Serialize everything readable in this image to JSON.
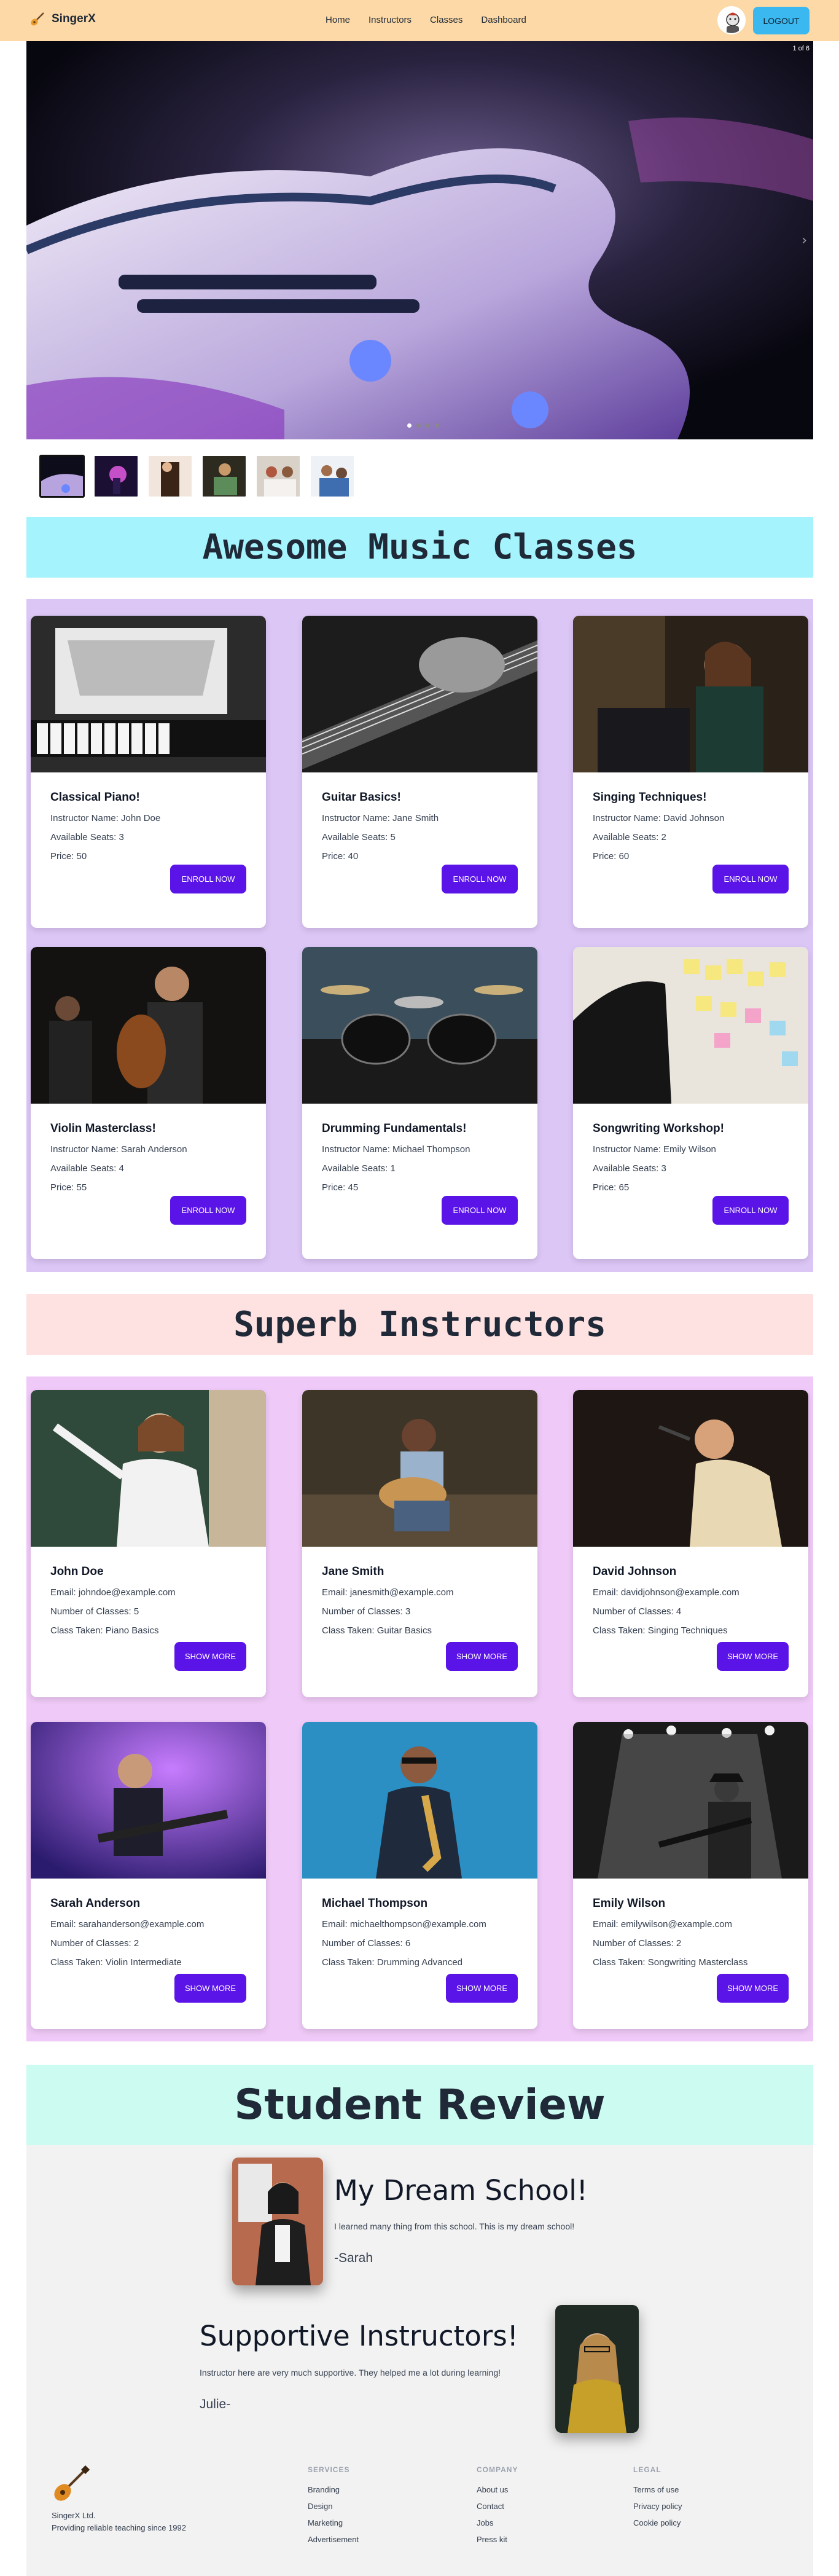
{
  "navbar": {
    "brand": "SingerX",
    "brand_icon": "guitar-icon",
    "links": [
      "Home",
      "Instructors",
      "Classes",
      "Dashboard"
    ],
    "logout_label": "LOGOUT"
  },
  "hero": {
    "counter": "1 of 6",
    "slide_count": 6,
    "active_slide": 1,
    "thumbnails": [
      "guitar",
      "concert",
      "violin",
      "guitarist",
      "duet",
      "band"
    ]
  },
  "classes_section": {
    "title": "Awesome Music Classes",
    "button_label": "ENROLL NOW",
    "cards": [
      {
        "title": "Classical Piano!",
        "instructor": "Instructor Name: John Doe",
        "seats": "Available Seats: 3",
        "price": "Price: 50"
      },
      {
        "title": "Guitar Basics!",
        "instructor": "Instructor Name: Jane Smith",
        "seats": "Available Seats: 5",
        "price": "Price: 40"
      },
      {
        "title": "Singing Techniques!",
        "instructor": "Instructor Name: David Johnson",
        "seats": "Available Seats: 2",
        "price": "Price: 60"
      },
      {
        "title": "Violin Masterclass!",
        "instructor": "Instructor Name: Sarah Anderson",
        "seats": "Available Seats: 4",
        "price": "Price: 55"
      },
      {
        "title": "Drumming Fundamentals!",
        "instructor": "Instructor Name: Michael Thompson",
        "seats": "Available Seats: 1",
        "price": "Price: 45"
      },
      {
        "title": "Songwriting Workshop!",
        "instructor": "Instructor Name: Emily Wilson",
        "seats": "Available Seats: 3",
        "price": "Price: 65"
      }
    ]
  },
  "instructors_section": {
    "title": "Superb Instructors",
    "button_label": "SHOW MORE",
    "cards": [
      {
        "name": "John Doe",
        "email": "Email: johndoe@example.com",
        "classes": "Number of Classes: 5",
        "taken": "Class Taken: Piano Basics"
      },
      {
        "name": "Jane Smith",
        "email": "Email: janesmith@example.com",
        "classes": "Number of Classes: 3",
        "taken": "Class Taken: Guitar Basics"
      },
      {
        "name": "David Johnson",
        "email": "Email: davidjohnson@example.com",
        "classes": "Number of Classes: 4",
        "taken": "Class Taken: Singing Techniques"
      },
      {
        "name": "Sarah Anderson",
        "email": "Email: sarahanderson@example.com",
        "classes": "Number of Classes: 2",
        "taken": "Class Taken: Violin Intermediate"
      },
      {
        "name": "Michael Thompson",
        "email": "Email: michaelthompson@example.com",
        "classes": "Number of Classes: 6",
        "taken": "Class Taken: Drumming Advanced"
      },
      {
        "name": "Emily Wilson",
        "email": "Email: emilywilson@example.com",
        "classes": "Number of Classes: 2",
        "taken": "Class Taken: Songwriting Masterclass"
      }
    ]
  },
  "review_section": {
    "title": "Student Review",
    "reviews": [
      {
        "heading": "My Dream School!",
        "text": "I learned many thing from this school. This is my dream school!",
        "author": "-Sarah"
      },
      {
        "heading": "Supportive Instructors!",
        "text": "Instructor here are very much supportive. They helped me a lot during learning!",
        "author": "Julie-"
      }
    ]
  },
  "footer": {
    "company_name": "SingerX Ltd.",
    "tagline": "Providing reliable teaching since 1992",
    "columns": [
      {
        "title": "SERVICES",
        "links": [
          "Branding",
          "Design",
          "Marketing",
          "Advertisement"
        ]
      },
      {
        "title": "COMPANY",
        "links": [
          "About us",
          "Contact",
          "Jobs",
          "Press kit"
        ]
      },
      {
        "title": "LEGAL",
        "links": [
          "Terms of use",
          "Privacy policy",
          "Cookie policy"
        ]
      }
    ]
  },
  "colors": {
    "navbar": "#fcd9a6",
    "logout": "#3bb8ef",
    "accent_button": "#5b14e8",
    "classes_banner": "#a5f3fc",
    "instructors_banner": "#fee2e2",
    "review_banner": "#ccfbf1"
  }
}
